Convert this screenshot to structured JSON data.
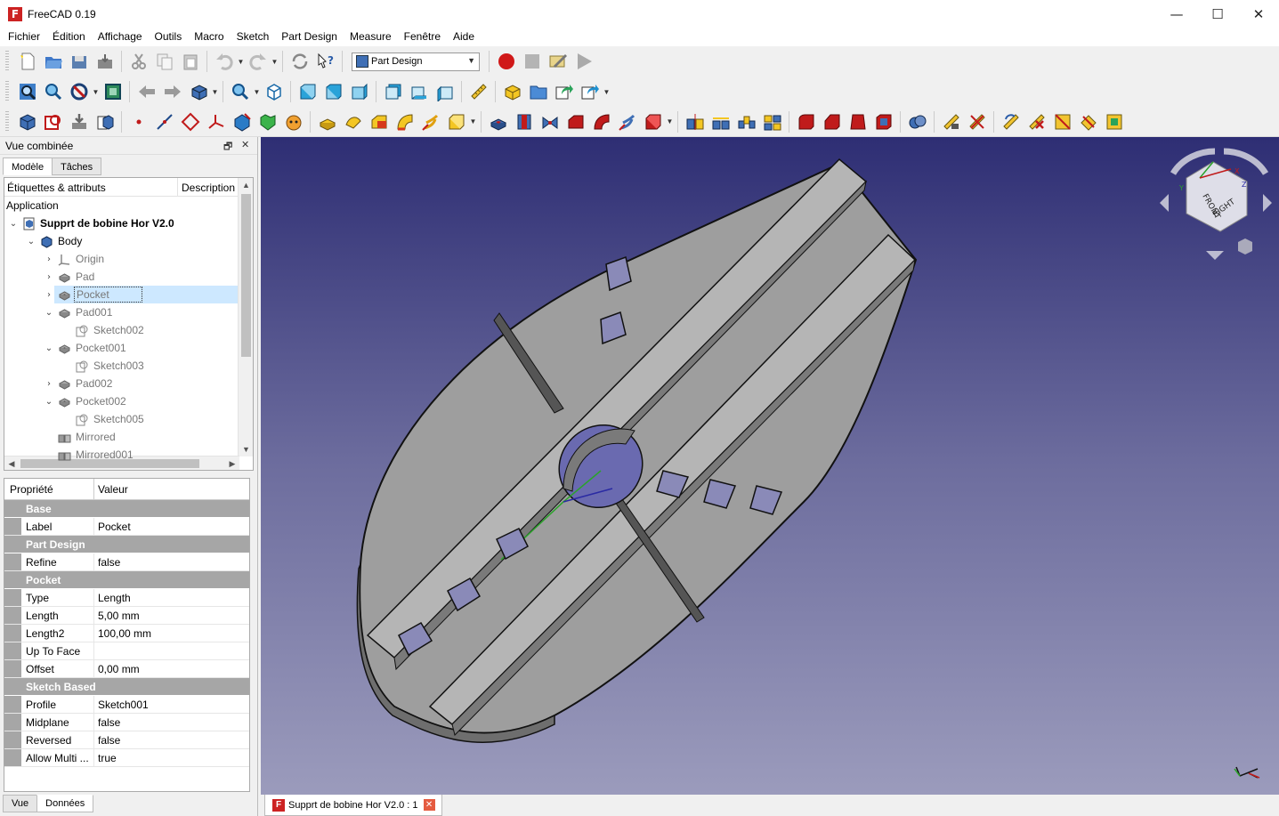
{
  "window": {
    "title": "FreeCAD 0.19",
    "minimize": "—",
    "maximize": "☐",
    "close": "✕"
  },
  "menu": [
    "Fichier",
    "Édition",
    "Affichage",
    "Outils",
    "Macro",
    "Sketch",
    "Part Design",
    "Measure",
    "Fenêtre",
    "Aide"
  ],
  "workbench": {
    "selected": "Part Design"
  },
  "combo": {
    "title": "Vue combinée",
    "tabs": [
      "Modèle",
      "Tâches"
    ],
    "active_tab": "Modèle"
  },
  "tree": {
    "col_labels": "Étiquettes & attributs",
    "col_description": "Description",
    "root": "Application",
    "items": [
      {
        "label": "Supprt de bobine Hor V2.0",
        "indent": 1,
        "chev": "v",
        "icon": "document-icon",
        "style": "bold"
      },
      {
        "label": "Body",
        "indent": 2,
        "chev": "v",
        "icon": "body-icon",
        "style": ""
      },
      {
        "label": "Origin",
        "indent": 3,
        "chev": ">",
        "icon": "origin-icon",
        "style": "dim"
      },
      {
        "label": "Pad",
        "indent": 3,
        "chev": ">",
        "icon": "pad-icon",
        "style": "dim"
      },
      {
        "label": "Pocket",
        "indent": 3,
        "chev": ">",
        "icon": "pocket-icon",
        "style": "dim sel"
      },
      {
        "label": "Pad001",
        "indent": 3,
        "chev": "v",
        "icon": "pad-icon",
        "style": "dim"
      },
      {
        "label": "Sketch002",
        "indent": 4,
        "chev": "",
        "icon": "sketch-icon",
        "style": "dim"
      },
      {
        "label": "Pocket001",
        "indent": 3,
        "chev": "v",
        "icon": "pocket-icon",
        "style": "dim"
      },
      {
        "label": "Sketch003",
        "indent": 4,
        "chev": "",
        "icon": "sketch-icon",
        "style": "dim"
      },
      {
        "label": "Pad002",
        "indent": 3,
        "chev": ">",
        "icon": "pad-icon",
        "style": "dim"
      },
      {
        "label": "Pocket002",
        "indent": 3,
        "chev": "v",
        "icon": "pocket-icon",
        "style": "dim"
      },
      {
        "label": "Sketch005",
        "indent": 4,
        "chev": "",
        "icon": "sketch-icon",
        "style": "dim"
      },
      {
        "label": "Mirrored",
        "indent": 3,
        "chev": "",
        "icon": "mirrored-icon",
        "style": "dim"
      },
      {
        "label": "Mirrored001",
        "indent": 3,
        "chev": "",
        "icon": "mirrored-icon",
        "style": "dim"
      }
    ]
  },
  "properties": {
    "col_property": "Propriété",
    "col_value": "Valeur",
    "groups": [
      {
        "name": "Base",
        "rows": [
          {
            "name": "Label",
            "value": "Pocket"
          }
        ]
      },
      {
        "name": "Part Design",
        "rows": [
          {
            "name": "Refine",
            "value": "false"
          }
        ]
      },
      {
        "name": "Pocket",
        "rows": [
          {
            "name": "Type",
            "value": "Length"
          },
          {
            "name": "Length",
            "value": "5,00 mm"
          },
          {
            "name": "Length2",
            "value": "100,00 mm"
          },
          {
            "name": "Up To Face",
            "value": ""
          },
          {
            "name": "Offset",
            "value": "0,00 mm"
          }
        ]
      },
      {
        "name": "Sketch Based",
        "rows": [
          {
            "name": "Profile",
            "value": "Sketch001"
          },
          {
            "name": "Midplane",
            "value": "false"
          },
          {
            "name": "Reversed",
            "value": "false"
          },
          {
            "name": "Allow Multi ...",
            "value": "true"
          }
        ]
      }
    ]
  },
  "bottom_tabs": [
    "Vue",
    "Données"
  ],
  "view_tab": {
    "label": "Supprt de bobine Hor V2.0 : 1"
  },
  "navcube": {
    "front_face": "FRONT",
    "right_face": "RIGHT",
    "x": "X",
    "y": "Y",
    "z": "Z"
  },
  "colors": {
    "accent": "#cde8ff",
    "record": "#d01818",
    "part_blue": "#3f6fb5",
    "viewport_top": "#2e2e74",
    "viewport_bottom": "#9b9bbc"
  }
}
